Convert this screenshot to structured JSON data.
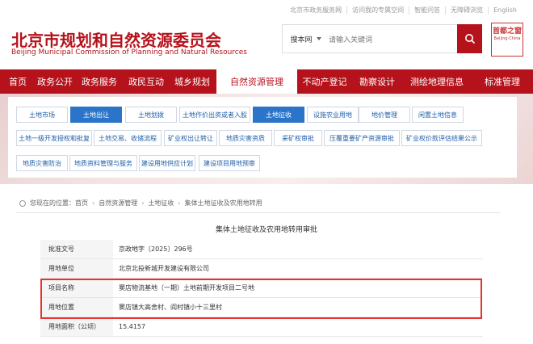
{
  "top_links": [
    "北京市政务服务网",
    "访问我的专属空间",
    "智能问答",
    "无障碍浏览",
    "English"
  ],
  "header": {
    "title_cn": "北京市规划和自然资源委员会",
    "title_en": "Beijing Municipal Commission of Planning and Natural Resources",
    "seal_text": "首都之窗",
    "seal_sub": "Beijing·China"
  },
  "search": {
    "scope": "搜本网",
    "placeholder": "请输入关键词"
  },
  "nav": [
    "首页",
    "政务公开",
    "政务服务",
    "政民互动",
    "城乡规划",
    "自然资源管理",
    "不动产登记",
    "勘察设计",
    "测绘地理信息",
    "标准管理"
  ],
  "submenu": {
    "row1": [
      "土地市场",
      "土地出让",
      "土地划拨",
      "土地作价出资或者入股",
      "土地征收",
      "设施农业用地",
      "地价管理",
      "闲置土地信息"
    ],
    "row2": [
      "土地一级开发授权和批复",
      "土地交易、收储流程",
      "矿业权出让转让",
      "地质灾害资质",
      "采矿权审批",
      "压覆重要矿产资源审批",
      "矿业权价款评估结果公示"
    ],
    "row3": [
      "地质灾害防治",
      "地质资料管理与服务",
      "建设用地供应计划",
      "建设项目用地预审"
    ],
    "active": [
      "土地出让",
      "土地征收"
    ]
  },
  "breadcrumb": {
    "prefix": "您现在的位置：",
    "items": [
      "首页",
      "自然资源管理",
      "土地征收",
      "集体土地征收及农用地转用"
    ]
  },
  "document": {
    "title": "集体土地征收及农用地转用审批",
    "rows": [
      {
        "label": "批准文号",
        "value": "京政地字〔2025〕296号"
      },
      {
        "label": "用地单位",
        "value": "北京北投新城开发建设有限公司"
      },
      {
        "label": "项目名称",
        "value": "窦店物流基地（一期）土地前期开发项目二号地"
      },
      {
        "label": "用地位置",
        "value": "窦店镇大高舍村、阎村镇小十三里村"
      },
      {
        "label": "用地面积（公顷）",
        "value": "15.4157"
      }
    ]
  },
  "colors": {
    "brand": "#b5121b",
    "chip_active": "#2a74c9",
    "highlight": "#e3342f"
  }
}
